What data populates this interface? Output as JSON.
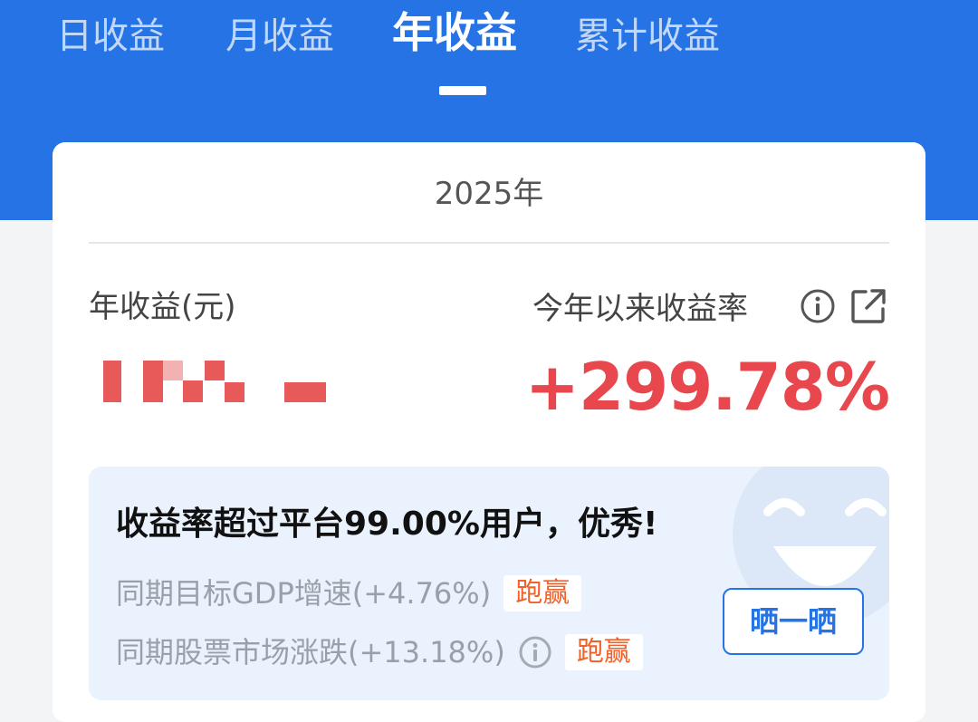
{
  "tabs": [
    {
      "label": "日收益",
      "active": false
    },
    {
      "label": "月收益",
      "active": false
    },
    {
      "label": "年收益",
      "active": true
    },
    {
      "label": "累计收益",
      "active": false
    }
  ],
  "card": {
    "year": "2025年",
    "income_label": "年收益(元)",
    "rate_label": "今年以来收益率",
    "rate_value": "+299.78%",
    "info_icon": "info-circle-icon",
    "share_icon": "external-share-icon"
  },
  "compare": {
    "headline": "收益率超过平台99.00%用户，优秀!",
    "rows": [
      {
        "text": "同期目标GDP增速(+4.76%)",
        "badge": "跑赢"
      },
      {
        "text": "同期股票市场涨跌(+13.18%)",
        "badge": "跑赢"
      }
    ],
    "button_label": "晒一晒"
  },
  "colors": {
    "brand_blue": "#2673e6",
    "gain_red": "#e8474d",
    "badge_orange": "#f0622a"
  }
}
